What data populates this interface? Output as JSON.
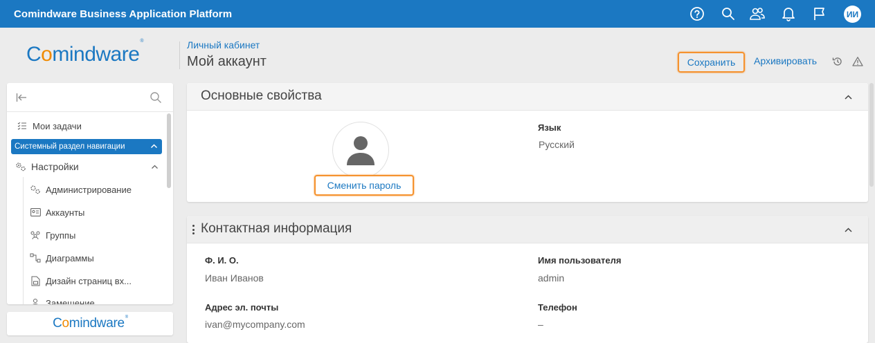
{
  "topbar": {
    "title": "Comindware Business Application Platform",
    "icons": [
      "help-icon",
      "search-icon",
      "users-icon",
      "bell-icon",
      "flag-icon"
    ],
    "user_initials": "ИИ"
  },
  "logo": {
    "text_a": "C",
    "text_o": "o",
    "text_b": "mindware",
    "registered": "®"
  },
  "header": {
    "breadcrumb": "Личный кабинет",
    "title": "Мой аккаунт",
    "save_label": "Сохранить",
    "archive_label": "Архивировать"
  },
  "sidebar": {
    "items": [
      {
        "label": "Мои задачи",
        "icon": "tasks-icon"
      },
      {
        "label": "Системный раздел навигации",
        "icon": "",
        "active": true
      },
      {
        "label": "Настройки",
        "icon": "settings-icon"
      },
      {
        "label": "Администрирование",
        "icon": "gears-icon"
      },
      {
        "label": "Аккаунты",
        "icon": "id-card-icon"
      },
      {
        "label": "Группы",
        "icon": "group-icon"
      },
      {
        "label": "Диаграммы",
        "icon": "diagram-icon"
      },
      {
        "label": "Дизайн страниц вх...",
        "icon": "page-design-icon"
      },
      {
        "label": "Замещение",
        "icon": "substitution-icon"
      }
    ]
  },
  "sidebar_logo": {
    "text_a": "C",
    "text_o": "o",
    "text_b": "mindware",
    "registered": "®"
  },
  "main_props": {
    "title": "Основные свойства",
    "change_password_label": "Сменить пароль",
    "language_label": "Язык",
    "language_value": "Русский"
  },
  "contact": {
    "title": "Контактная информация",
    "fio_label": "Ф. И. О.",
    "fio_value": "Иван Иванов",
    "username_label": "Имя пользователя",
    "username_value": "admin",
    "email_label": "Адрес эл. почты",
    "email_value": "ivan@mycompany.com",
    "phone_label": "Телефон",
    "phone_value": "–"
  },
  "colors": {
    "accent": "#1b78c2",
    "highlight": "#f5922e",
    "logo_orange": "#f08a00"
  }
}
